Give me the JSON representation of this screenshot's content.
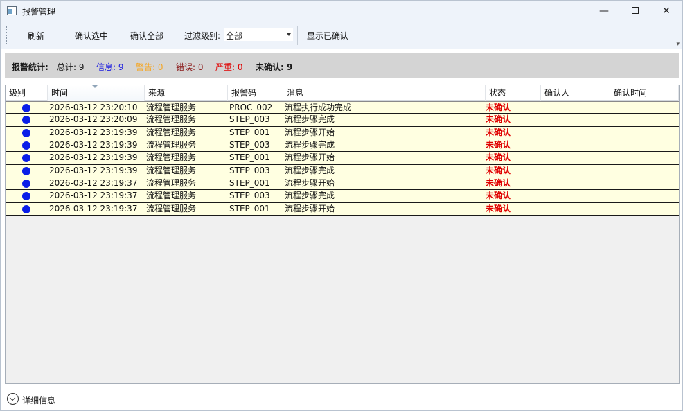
{
  "window": {
    "title": "报警管理",
    "minimize_glyph": "—",
    "close_glyph": "✕"
  },
  "toolbar": {
    "refresh_label": "刷新",
    "confirm_selected_label": "确认选中",
    "confirm_all_label": "确认全部",
    "filter_label": "过滤级别:",
    "filter_value": "全部",
    "show_confirmed_label": "显示已确认",
    "overflow_glyph": "▾"
  },
  "stats": {
    "title": "报警统计:",
    "total": "总计: 9",
    "info": "信息: 9",
    "warning": "警告: 0",
    "error": "错误: 0",
    "critical": "严重: 0",
    "unconfirmed": "未确认: 9",
    "colors": {
      "info": "#2020e0",
      "warning": "#f5a623",
      "error": "#8b1a1a",
      "critical": "#e00000"
    }
  },
  "grid": {
    "columns": [
      "级别",
      "时间",
      "来源",
      "报警码",
      "消息",
      "状态",
      "确认人",
      "确认时间"
    ],
    "sorted_column": "时间",
    "level_icon": "blue-dot-icon",
    "rows": [
      {
        "time": "2026-03-12 23:20:10",
        "source": "流程管理服务",
        "code": "PROC_002",
        "message": "流程执行成功完成",
        "status": "未确认",
        "confirmed_by": "",
        "confirmed_time": ""
      },
      {
        "time": "2026-03-12 23:20:09",
        "source": "流程管理服务",
        "code": "STEP_003",
        "message": "流程步骤完成",
        "status": "未确认",
        "confirmed_by": "",
        "confirmed_time": ""
      },
      {
        "time": "2026-03-12 23:19:39",
        "source": "流程管理服务",
        "code": "STEP_001",
        "message": "流程步骤开始",
        "status": "未确认",
        "confirmed_by": "",
        "confirmed_time": ""
      },
      {
        "time": "2026-03-12 23:19:39",
        "source": "流程管理服务",
        "code": "STEP_003",
        "message": "流程步骤完成",
        "status": "未确认",
        "confirmed_by": "",
        "confirmed_time": ""
      },
      {
        "time": "2026-03-12 23:19:39",
        "source": "流程管理服务",
        "code": "STEP_001",
        "message": "流程步骤开始",
        "status": "未确认",
        "confirmed_by": "",
        "confirmed_time": ""
      },
      {
        "time": "2026-03-12 23:19:39",
        "source": "流程管理服务",
        "code": "STEP_003",
        "message": "流程步骤完成",
        "status": "未确认",
        "confirmed_by": "",
        "confirmed_time": ""
      },
      {
        "time": "2026-03-12 23:19:37",
        "source": "流程管理服务",
        "code": "STEP_001",
        "message": "流程步骤开始",
        "status": "未确认",
        "confirmed_by": "",
        "confirmed_time": ""
      },
      {
        "time": "2026-03-12 23:19:37",
        "source": "流程管理服务",
        "code": "STEP_003",
        "message": "流程步骤完成",
        "status": "未确认",
        "confirmed_by": "",
        "confirmed_time": ""
      },
      {
        "time": "2026-03-12 23:19:37",
        "source": "流程管理服务",
        "code": "STEP_001",
        "message": "流程步骤开始",
        "status": "未确认",
        "confirmed_by": "",
        "confirmed_time": ""
      }
    ]
  },
  "footer": {
    "details_label": "详细信息"
  }
}
